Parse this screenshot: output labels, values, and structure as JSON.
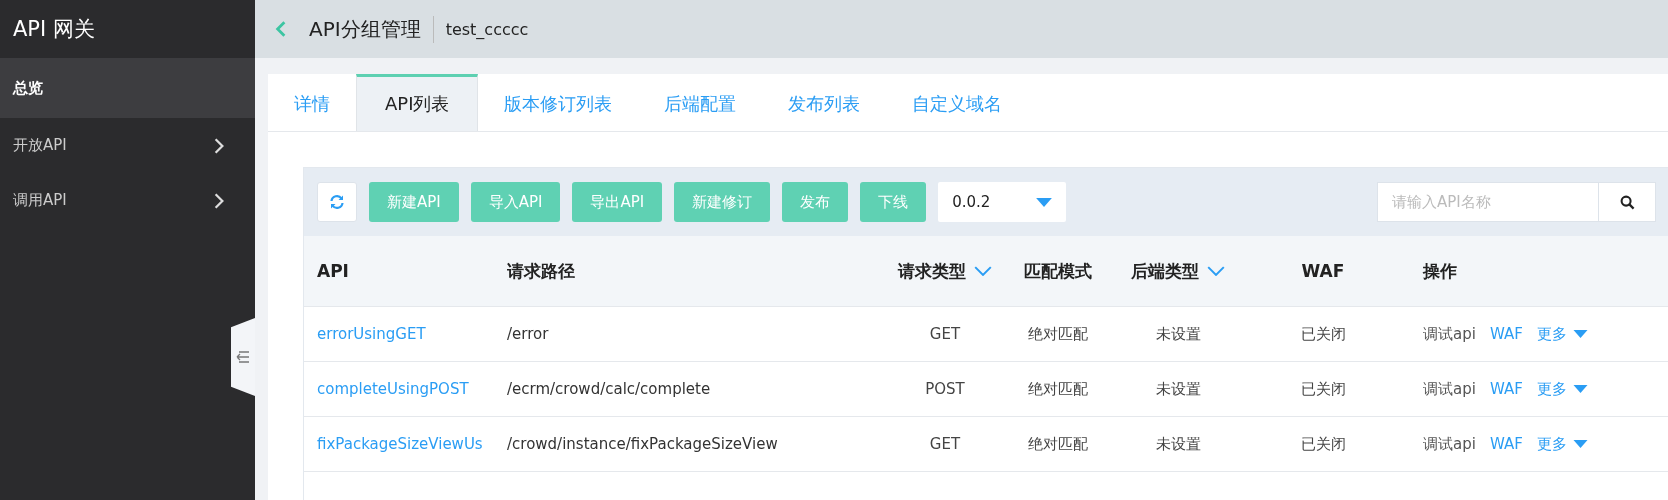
{
  "sidebar": {
    "title": "API 网关",
    "items": [
      {
        "label": "总览",
        "selected": true,
        "expandable": false
      },
      {
        "label": "开放API",
        "selected": false,
        "expandable": true
      },
      {
        "label": "调用API",
        "selected": false,
        "expandable": true
      }
    ]
  },
  "header": {
    "title": "API分组管理",
    "subtitle": "test_ccccc"
  },
  "tabs": [
    {
      "label": "详情",
      "selected": false
    },
    {
      "label": "API列表",
      "selected": true
    },
    {
      "label": "版本修订列表",
      "selected": false
    },
    {
      "label": "后端配置",
      "selected": false
    },
    {
      "label": "发布列表",
      "selected": false
    },
    {
      "label": "自定义域名",
      "selected": false
    }
  ],
  "toolbar": {
    "buttons": [
      "新建API",
      "导入API",
      "导出API",
      "新建修订",
      "发布",
      "下线"
    ],
    "version": "0.0.2",
    "search": {
      "placeholder": "请输入API名称"
    }
  },
  "table": {
    "columns": [
      {
        "label": "API",
        "sortable": false
      },
      {
        "label": "请求路径",
        "sortable": false
      },
      {
        "label": "请求类型",
        "sortable": true
      },
      {
        "label": "匹配模式",
        "sortable": false
      },
      {
        "label": "后端类型",
        "sortable": true
      },
      {
        "label": "WAF",
        "sortable": false
      },
      {
        "label": "操作",
        "sortable": false
      }
    ],
    "rows": [
      {
        "cells": [
          "errorUsingGET",
          "/error",
          "GET",
          "绝对匹配",
          "未设置",
          "已关闭"
        ],
        "actions": [
          {
            "label": "调试api",
            "kind": "plain"
          },
          {
            "label": "WAF",
            "kind": "link"
          },
          {
            "label": "更多",
            "kind": "dropdown"
          }
        ]
      },
      {
        "cells": [
          "completeUsingPOST",
          "/ecrm/crowd/calc/complete",
          "POST",
          "绝对匹配",
          "未设置",
          "已关闭"
        ],
        "actions": [
          {
            "label": "调试api",
            "kind": "plain"
          },
          {
            "label": "WAF",
            "kind": "link"
          },
          {
            "label": "更多",
            "kind": "dropdown"
          }
        ]
      },
      {
        "cells": [
          "fixPackageSizeViewUs",
          "/crowd/instance/fixPackageSizeView",
          "GET",
          "绝对匹配",
          "未设置",
          "已关闭"
        ],
        "actions": [
          {
            "label": "调试api",
            "kind": "plain"
          },
          {
            "label": "WAF",
            "kind": "link"
          },
          {
            "label": "更多",
            "kind": "dropdown"
          }
        ]
      }
    ]
  }
}
